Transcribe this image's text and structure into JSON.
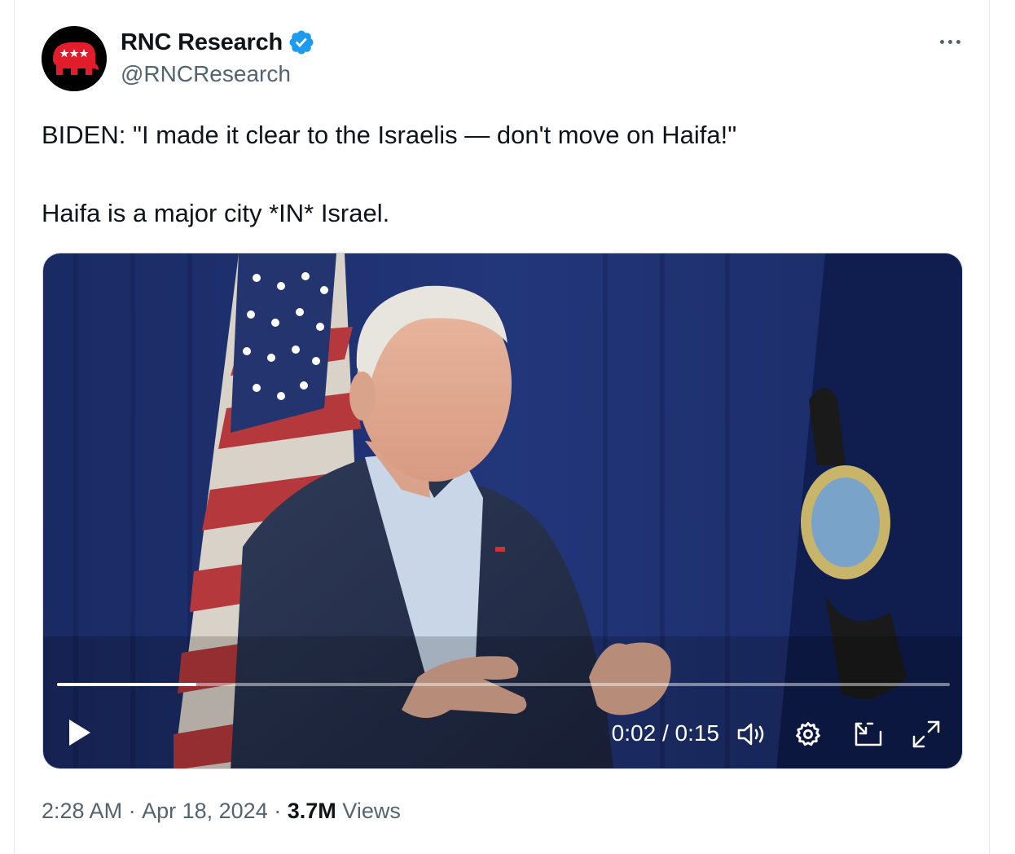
{
  "author": {
    "name": "RNC Research",
    "handle": "@RNCResearch",
    "avatar_icon": "republican-elephant-icon",
    "verified_icon": "verified-badge-icon",
    "brand_red": "#e11d2b",
    "verified_blue": "#1d9bf0"
  },
  "tweet": {
    "line1": "BIDEN: \"I made it clear to the Israelis — don't move on Haifa!\"",
    "line2": "Haifa is a major city *IN* Israel."
  },
  "video": {
    "current_time": "0:02",
    "duration": "0:15",
    "time_separator": "/",
    "progress_fraction": 0.156,
    "controls": [
      "play-icon",
      "volume-icon",
      "settings-gear-icon",
      "picture-in-picture-icon",
      "fullscreen-icon"
    ]
  },
  "meta": {
    "time": "2:28 AM",
    "separator": "·",
    "date": "Apr 18, 2024",
    "views_count": "3.7M",
    "views_label": "Views"
  },
  "more_icon": "more-options-icon"
}
